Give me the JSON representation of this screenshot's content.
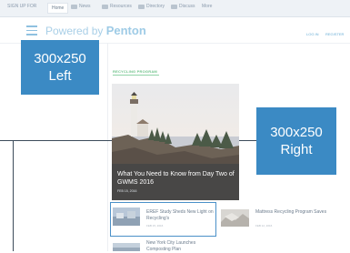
{
  "topbar": {
    "items": [
      {
        "label": "SIGN UP FOR",
        "icon": "none"
      },
      {
        "label": "Home",
        "icon": "none",
        "active": true
      },
      {
        "label": "News",
        "icon": "news-icon"
      },
      {
        "label": "Resources",
        "icon": "resources-icon"
      },
      {
        "label": "Directory",
        "icon": "directory-icon"
      },
      {
        "label": "Discuss",
        "icon": "discuss-icon"
      },
      {
        "label": "More",
        "icon": "none"
      }
    ]
  },
  "header": {
    "powered_by": "Powered by",
    "brand": "Penton",
    "login": "LOG IN",
    "register": "REGISTER"
  },
  "ads": {
    "left": {
      "size": "300x250",
      "label": "Left"
    },
    "right": {
      "size": "300x250",
      "label": "Right"
    }
  },
  "section": {
    "label": "RECYCLING PROGRAM"
  },
  "hero": {
    "title": "What You Need to Know from Day Two of GWMS 2016",
    "date": "FEB 15, 2016"
  },
  "cards": [
    {
      "title": "EREF Study Sheds New Light on Recycling's",
      "date": "FEB 15, 2016"
    },
    {
      "title": "Mattress Recycling Program Saves",
      "date": "FEB 12, 2016"
    },
    {
      "title": "New York City Launches Composting Plan",
      "date": "FEB 11, 2016"
    }
  ],
  "colors": {
    "accent": "#3b8ac4",
    "brand": "#9ecbe6",
    "section": "#6fc28a"
  }
}
